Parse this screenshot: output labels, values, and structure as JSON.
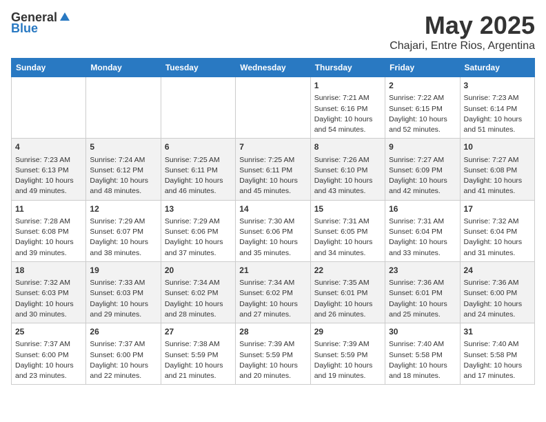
{
  "header": {
    "logo_general": "General",
    "logo_blue": "Blue",
    "title": "May 2025",
    "subtitle": "Chajari, Entre Rios, Argentina"
  },
  "weekdays": [
    "Sunday",
    "Monday",
    "Tuesday",
    "Wednesday",
    "Thursday",
    "Friday",
    "Saturday"
  ],
  "weeks": [
    [
      {
        "day": "",
        "content": ""
      },
      {
        "day": "",
        "content": ""
      },
      {
        "day": "",
        "content": ""
      },
      {
        "day": "",
        "content": ""
      },
      {
        "day": "1",
        "content": "Sunrise: 7:21 AM\nSunset: 6:16 PM\nDaylight: 10 hours\nand 54 minutes."
      },
      {
        "day": "2",
        "content": "Sunrise: 7:22 AM\nSunset: 6:15 PM\nDaylight: 10 hours\nand 52 minutes."
      },
      {
        "day": "3",
        "content": "Sunrise: 7:23 AM\nSunset: 6:14 PM\nDaylight: 10 hours\nand 51 minutes."
      }
    ],
    [
      {
        "day": "4",
        "content": "Sunrise: 7:23 AM\nSunset: 6:13 PM\nDaylight: 10 hours\nand 49 minutes."
      },
      {
        "day": "5",
        "content": "Sunrise: 7:24 AM\nSunset: 6:12 PM\nDaylight: 10 hours\nand 48 minutes."
      },
      {
        "day": "6",
        "content": "Sunrise: 7:25 AM\nSunset: 6:11 PM\nDaylight: 10 hours\nand 46 minutes."
      },
      {
        "day": "7",
        "content": "Sunrise: 7:25 AM\nSunset: 6:11 PM\nDaylight: 10 hours\nand 45 minutes."
      },
      {
        "day": "8",
        "content": "Sunrise: 7:26 AM\nSunset: 6:10 PM\nDaylight: 10 hours\nand 43 minutes."
      },
      {
        "day": "9",
        "content": "Sunrise: 7:27 AM\nSunset: 6:09 PM\nDaylight: 10 hours\nand 42 minutes."
      },
      {
        "day": "10",
        "content": "Sunrise: 7:27 AM\nSunset: 6:08 PM\nDaylight: 10 hours\nand 41 minutes."
      }
    ],
    [
      {
        "day": "11",
        "content": "Sunrise: 7:28 AM\nSunset: 6:08 PM\nDaylight: 10 hours\nand 39 minutes."
      },
      {
        "day": "12",
        "content": "Sunrise: 7:29 AM\nSunset: 6:07 PM\nDaylight: 10 hours\nand 38 minutes."
      },
      {
        "day": "13",
        "content": "Sunrise: 7:29 AM\nSunset: 6:06 PM\nDaylight: 10 hours\nand 37 minutes."
      },
      {
        "day": "14",
        "content": "Sunrise: 7:30 AM\nSunset: 6:06 PM\nDaylight: 10 hours\nand 35 minutes."
      },
      {
        "day": "15",
        "content": "Sunrise: 7:31 AM\nSunset: 6:05 PM\nDaylight: 10 hours\nand 34 minutes."
      },
      {
        "day": "16",
        "content": "Sunrise: 7:31 AM\nSunset: 6:04 PM\nDaylight: 10 hours\nand 33 minutes."
      },
      {
        "day": "17",
        "content": "Sunrise: 7:32 AM\nSunset: 6:04 PM\nDaylight: 10 hours\nand 31 minutes."
      }
    ],
    [
      {
        "day": "18",
        "content": "Sunrise: 7:32 AM\nSunset: 6:03 PM\nDaylight: 10 hours\nand 30 minutes."
      },
      {
        "day": "19",
        "content": "Sunrise: 7:33 AM\nSunset: 6:03 PM\nDaylight: 10 hours\nand 29 minutes."
      },
      {
        "day": "20",
        "content": "Sunrise: 7:34 AM\nSunset: 6:02 PM\nDaylight: 10 hours\nand 28 minutes."
      },
      {
        "day": "21",
        "content": "Sunrise: 7:34 AM\nSunset: 6:02 PM\nDaylight: 10 hours\nand 27 minutes."
      },
      {
        "day": "22",
        "content": "Sunrise: 7:35 AM\nSunset: 6:01 PM\nDaylight: 10 hours\nand 26 minutes."
      },
      {
        "day": "23",
        "content": "Sunrise: 7:36 AM\nSunset: 6:01 PM\nDaylight: 10 hours\nand 25 minutes."
      },
      {
        "day": "24",
        "content": "Sunrise: 7:36 AM\nSunset: 6:00 PM\nDaylight: 10 hours\nand 24 minutes."
      }
    ],
    [
      {
        "day": "25",
        "content": "Sunrise: 7:37 AM\nSunset: 6:00 PM\nDaylight: 10 hours\nand 23 minutes."
      },
      {
        "day": "26",
        "content": "Sunrise: 7:37 AM\nSunset: 6:00 PM\nDaylight: 10 hours\nand 22 minutes."
      },
      {
        "day": "27",
        "content": "Sunrise: 7:38 AM\nSunset: 5:59 PM\nDaylight: 10 hours\nand 21 minutes."
      },
      {
        "day": "28",
        "content": "Sunrise: 7:39 AM\nSunset: 5:59 PM\nDaylight: 10 hours\nand 20 minutes."
      },
      {
        "day": "29",
        "content": "Sunrise: 7:39 AM\nSunset: 5:59 PM\nDaylight: 10 hours\nand 19 minutes."
      },
      {
        "day": "30",
        "content": "Sunrise: 7:40 AM\nSunset: 5:58 PM\nDaylight: 10 hours\nand 18 minutes."
      },
      {
        "day": "31",
        "content": "Sunrise: 7:40 AM\nSunset: 5:58 PM\nDaylight: 10 hours\nand 17 minutes."
      }
    ]
  ]
}
